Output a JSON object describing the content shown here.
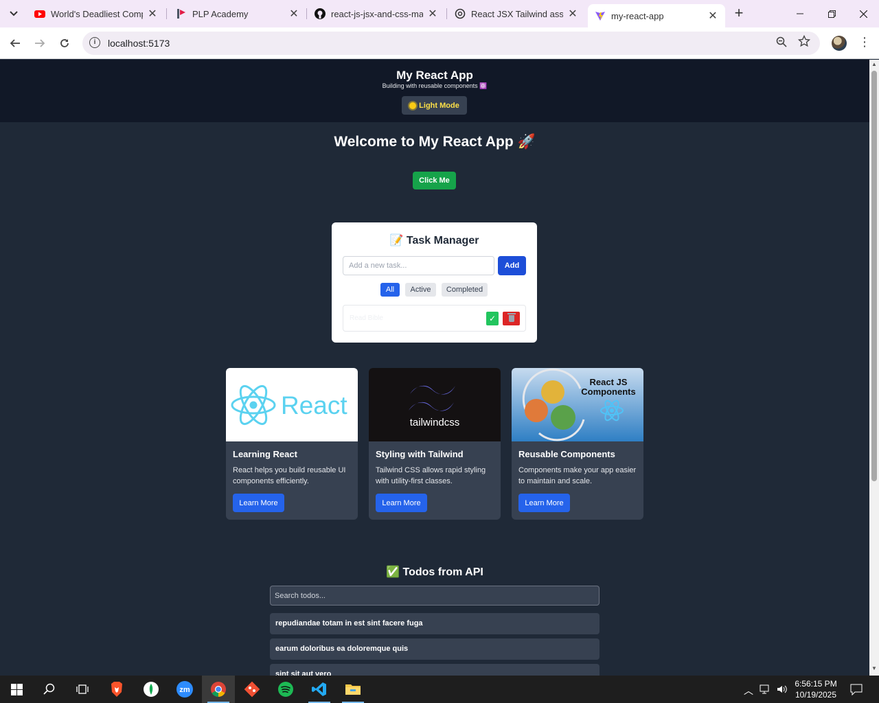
{
  "browser": {
    "tabs": [
      {
        "title": "World's Deadliest Compu",
        "icon": "youtube-icon"
      },
      {
        "title": "PLP Academy",
        "icon": "plp-icon"
      },
      {
        "title": "react-js-jsx-and-css-mast",
        "icon": "github-icon"
      },
      {
        "title": "React JSX Tailwind assign",
        "icon": "chatgpt-icon"
      },
      {
        "title": "my-react-app",
        "icon": "vite-icon",
        "active": true
      }
    ],
    "url": "localhost:5173"
  },
  "app": {
    "title": "My React App",
    "subtitle": "Building with reusable components ⚛️",
    "theme_button": "Light Mode",
    "welcome": "Welcome to My React App 🚀",
    "click_button": "Click Me"
  },
  "task_manager": {
    "title": "📝 Task Manager",
    "input_placeholder": "Add a new task...",
    "add_label": "Add",
    "filters": [
      "All",
      "Active",
      "Completed"
    ],
    "active_filter": "All",
    "tasks": [
      {
        "text": "Read Bible",
        "completed": false
      }
    ]
  },
  "features": [
    {
      "title": "Learning React",
      "description": "React helps you build reusable UI components efficiently.",
      "button": "Learn More",
      "image_text": "React"
    },
    {
      "title": "Styling with Tailwind",
      "description": "Tailwind CSS allows rapid styling with utility-first classes.",
      "button": "Learn More",
      "image_text": "tailwindcss"
    },
    {
      "title": "Reusable Components",
      "description": "Components make your app easier to maintain and scale.",
      "button": "Learn More",
      "image_text": "React JS Components"
    }
  ],
  "todos": {
    "title": "✅ Todos from API",
    "search_placeholder": "Search todos...",
    "items": [
      "repudiandae totam in est sint facere fuga",
      "earum doloribus ea doloremque quis",
      "sint sit aut vero"
    ]
  },
  "taskbar": {
    "time": "6:56:15 PM",
    "date": "10/19/2025"
  },
  "colors": {
    "page_bg": "#1f2937",
    "header_bg": "#111827",
    "accent_blue": "#2563eb",
    "green": "#16a34a",
    "red": "#dc2626"
  }
}
